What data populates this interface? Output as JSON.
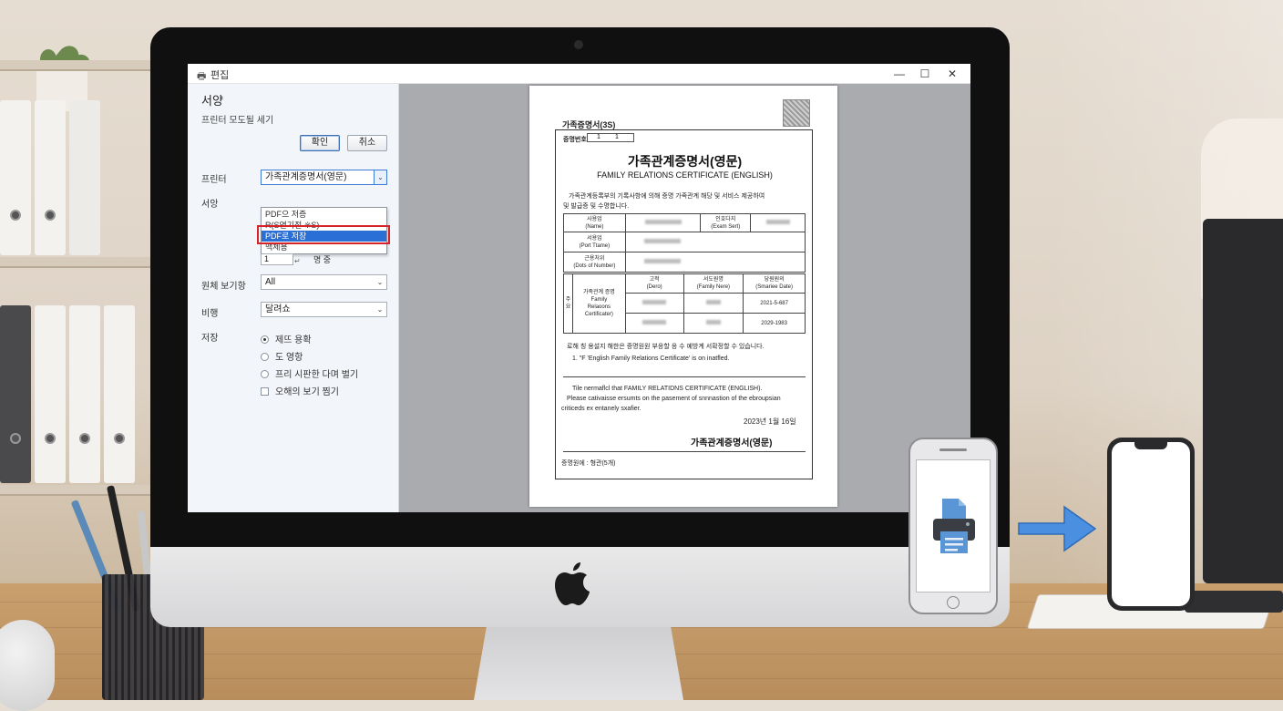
{
  "window": {
    "title": "편집",
    "controls": {
      "minimize": "—",
      "maximize": "☐",
      "close": "✕"
    }
  },
  "left_panel": {
    "heading": "서양",
    "subheading": "프린터 모도될 세기",
    "ok_label": "확인",
    "cancel_label": "취소",
    "printer_label": "프린터",
    "printer_value": "가족관계증명서(영문)",
    "dropdown_options": [
      "PDF으 저증",
      "R(S연기전 ※S)",
      "PDF로 저장",
      "맥체용"
    ],
    "selected_option": "PDF로 저장",
    "copies_label": "서앙",
    "copies_value": "1",
    "copies_suffix": "명 중",
    "pages_label": "원체 보기항",
    "pages_value": "All",
    "layout_label": "비행",
    "layout_value": "달려쇼",
    "options_label": "저장",
    "radio_options": [
      "제뜨 용확",
      "도 영항",
      "프리 시판한 다며 벌기"
    ],
    "checkbox_label": "오해의 보기 찜기"
  },
  "document": {
    "code": "가족증명서(3S)",
    "num_label": "증명번호",
    "num_values": [
      "1",
      "1"
    ],
    "title_ko": "가족관계증명서(영문)",
    "title_en": "FAMILY RELATIONS CERTIFICATE (ENGLISH)",
    "intro_1": "가족관계등록부의 기록사항에 의해 증명 가족관계 해당 및 서비스 제공하여",
    "intro_2": "및 발급증 및 수명합니다.",
    "row1_label_ko": "사용업",
    "row1_label_en": "(Name)",
    "row1_label2_ko": "인호다지",
    "row1_label2_en": "(Exam Sert)",
    "row2_label_ko": "서용업",
    "row2_label_en": "(Port Ttame)",
    "row3_label_ko": "근용처위",
    "row3_label_en": "(Dots of Number)",
    "family_header_left": [
      "고적",
      "(Dero)"
    ],
    "family_header_mid": [
      "서도원명",
      "(Family Nere)"
    ],
    "family_header_right": [
      "당원원의",
      "(Smariee Date)"
    ],
    "side_label": "주 요",
    "family_type_ko": "가족관계 증명",
    "family_type_en_1": "Family",
    "family_type_en_2": "Relaoons",
    "family_type_en_3": "Certificater)",
    "family_date_1": "2021-5-687",
    "family_date_2": "2029-1983",
    "note_ko": "로해 칭 용설지 해한은 증명원원 부응할 응 수 예방계 서확정할 수 있습니다.",
    "note_en": "1. \"F 'English Family Relations Certificate' is on inatfled.",
    "footer_1": "Tile nermaflcl that FAMILY RELATIDNS CERTIFICATE (ENGLISH).",
    "footer_2": "Please cativaisse ersumts on the pasement of snnnastion of the ebroupsian",
    "footer_3": "criticeds ex entanely sxafier.",
    "date": "2023년   1월   16일",
    "signature": "가족관계증명서(영문)",
    "issuer": "증명원에 : 형관(5개)"
  },
  "colors": {
    "accent": "#2a6fd6",
    "highlight": "#d6232a",
    "panel_bg": "#f2f5f9",
    "preview_bg": "#a9abaf",
    "arrow": "#4a8fe0"
  },
  "icons": [
    "printer-icon",
    "apple-logo",
    "arrow-right-icon",
    "chevron-down-icon",
    "title-printer-icon"
  ]
}
